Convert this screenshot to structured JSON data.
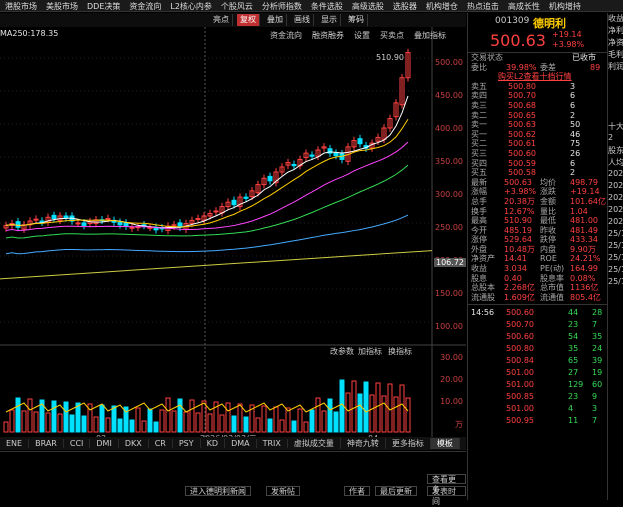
{
  "menu": [
    "港股市场",
    "美股市场",
    "DDE决策",
    "资金流向",
    "L2核心内参",
    "个股风云",
    "分析师指数",
    "条件选股",
    "高级选股",
    "选股器",
    "机构增仓",
    "热点追击",
    "高成长性",
    "机构增持"
  ],
  "toolbar": [
    "亮点",
    "复权",
    "叠加",
    "画线",
    "显示",
    "筹码"
  ],
  "toolbar_active": "复权",
  "ma_label": "MA250:178.35",
  "sub_toolbar": [
    "资金流向",
    "融资融券",
    "设置",
    "买卖点",
    "叠加指标"
  ],
  "price_axis": [
    "500.00",
    "450.00",
    "400.00",
    "350.00",
    "300.00",
    "250.00",
    "200.00",
    "150.00",
    "100.00"
  ],
  "high_label": "510.90",
  "last_price_tag": "106.72",
  "volume_axis": [
    "30.00",
    "20.00",
    "10.00"
  ],
  "vol_unit": "万",
  "x_dates": [
    "02",
    "2026/03/03/二",
    "04"
  ],
  "vol_toolbar": [
    "改参数",
    "加指标",
    "换指标"
  ],
  "bottom_tabs": [
    "ENE",
    "BRAR",
    "CCI",
    "DMI",
    "DKX",
    "CR",
    "PSY",
    "KD",
    "DMA",
    "TRIX",
    "虚拟成交量",
    "神奇九转",
    "更多指标",
    "模板"
  ],
  "bottom_active": "模板",
  "news_buttons": [
    "进入德明利新闻",
    "发新帖",
    "作者",
    "最后更新",
    "发表时间",
    "查看更多"
  ],
  "quote": {
    "code": "001309",
    "name": "德明利",
    "price": "500.63",
    "change": "+19.14",
    "pct": "+3.98%",
    "status_label": "交易状态",
    "status": "已收市",
    "weibi_label": "委比",
    "weibi": "39.98%",
    "weicha_label": "委差",
    "weicha": "89",
    "l2_link": "购买L2查看十档行情",
    "sell": [
      [
        "卖五",
        "500.80",
        "3"
      ],
      [
        "卖四",
        "500.70",
        "6"
      ],
      [
        "卖三",
        "500.68",
        "6"
      ],
      [
        "卖二",
        "500.65",
        "2"
      ],
      [
        "卖一",
        "500.63",
        "50"
      ]
    ],
    "buy": [
      [
        "买一",
        "500.62",
        "46"
      ],
      [
        "买二",
        "500.61",
        "75"
      ],
      [
        "买三",
        "500.60",
        "26"
      ],
      [
        "买四",
        "500.59",
        "6"
      ],
      [
        "买五",
        "500.58",
        "2"
      ]
    ],
    "stats": [
      [
        "最新",
        "500.63",
        "均价",
        "498.79"
      ],
      [
        "涨幅",
        "+3.98%",
        "涨跌",
        "+19.14"
      ],
      [
        "总手",
        "20.38万",
        "金额",
        "101.64亿"
      ],
      [
        "换手",
        "12.67%",
        "量比",
        "1.04"
      ],
      [
        "最高",
        "510.90",
        "最低",
        "481.00"
      ],
      [
        "今开",
        "485.19",
        "昨收",
        "481.49"
      ],
      [
        "涨停",
        "529.64",
        "跌停",
        "433.34"
      ],
      [
        "外盘",
        "10.48万",
        "内盘",
        "9.90万"
      ],
      [
        "净资产",
        "14.41",
        "ROE",
        "24.21%"
      ],
      [
        "收益",
        "3.034",
        "PE(动)",
        "164.99"
      ],
      [
        "股息",
        "0.40",
        "股息率",
        "0.08%"
      ],
      [
        "总股本",
        "2.268亿",
        "总市值",
        "1136亿"
      ],
      [
        "流通股",
        "1.609亿",
        "流通值",
        "805.4亿"
      ]
    ],
    "ticks": [
      [
        "14:56",
        "500.60",
        "44",
        "28"
      ],
      [
        "",
        "500.70",
        "23",
        "7"
      ],
      [
        "",
        "500.60",
        "54",
        "35"
      ],
      [
        "",
        "500.80",
        "35",
        "24"
      ],
      [
        "",
        "500.84",
        "65",
        "39"
      ],
      [
        "",
        "501.00",
        "27",
        "19"
      ],
      [
        "",
        "501.00",
        "129",
        "60"
      ],
      [
        "",
        "500.85",
        "23",
        "9"
      ],
      [
        "",
        "501.00",
        "4",
        "3"
      ],
      [
        "",
        "500.95",
        "11",
        "7"
      ]
    ]
  },
  "far_right": [
    "收益",
    "净利",
    "净资",
    "毛利",
    "利润",
    "",
    "",
    "",
    "",
    "十大",
    "2",
    "股东",
    "人均",
    "2026",
    "2025",
    "2025",
    "2025",
    "2025",
    "25/1",
    "25/1",
    "25/1",
    "25/1",
    "25/1"
  ],
  "colors": {
    "up": "#ff4040",
    "down": "#00e0ff",
    "ma5": "#ffffff",
    "ma10": "#ffcc00",
    "ma20": "#ff44ff",
    "ma30": "#33dd55",
    "ma60": "#44aaff",
    "ma250": "#cccc44"
  }
}
